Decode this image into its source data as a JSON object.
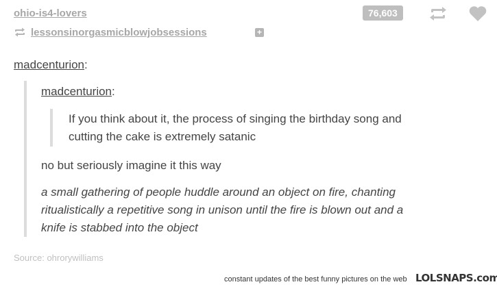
{
  "header": {
    "blog_name": "ohio-is4-lovers",
    "note_count": "76,603",
    "reblogged_from": "lessonsinorgasmicblowjobsessions"
  },
  "post": {
    "outer_user": "madcenturion",
    "inner_user": "madcenturion",
    "colon": ":",
    "quoted_text_1": "If you think about it, the process of singing the birthday song and",
    "quoted_text_2": "cutting the cake is extremely satanic",
    "reply_1": "no but seriously imagine it this way",
    "reply_2_line1": "a small gathering of people huddle around an object on fire, chanting",
    "reply_2_line2": "ritualistically a repetitive song in unison until the fire is blown out and a",
    "reply_2_line3": "knife is stabbed into the object"
  },
  "source": {
    "label": "Source:",
    "name": "ohrorywilliams"
  },
  "footer": {
    "tagline": "constant updates of the best funny pictures on the web",
    "brand": "LOLSNAPS.com"
  },
  "colors": {
    "link_gray": "#a7a7a7",
    "text": "#444444",
    "quote_bar": "#dcdcdc",
    "badge_bg": "#bebebe"
  },
  "icons": {
    "reblog": "reblog-icon",
    "like": "heart-icon",
    "reblog_small": "reblog-small-icon",
    "follow": "plus-icon"
  }
}
